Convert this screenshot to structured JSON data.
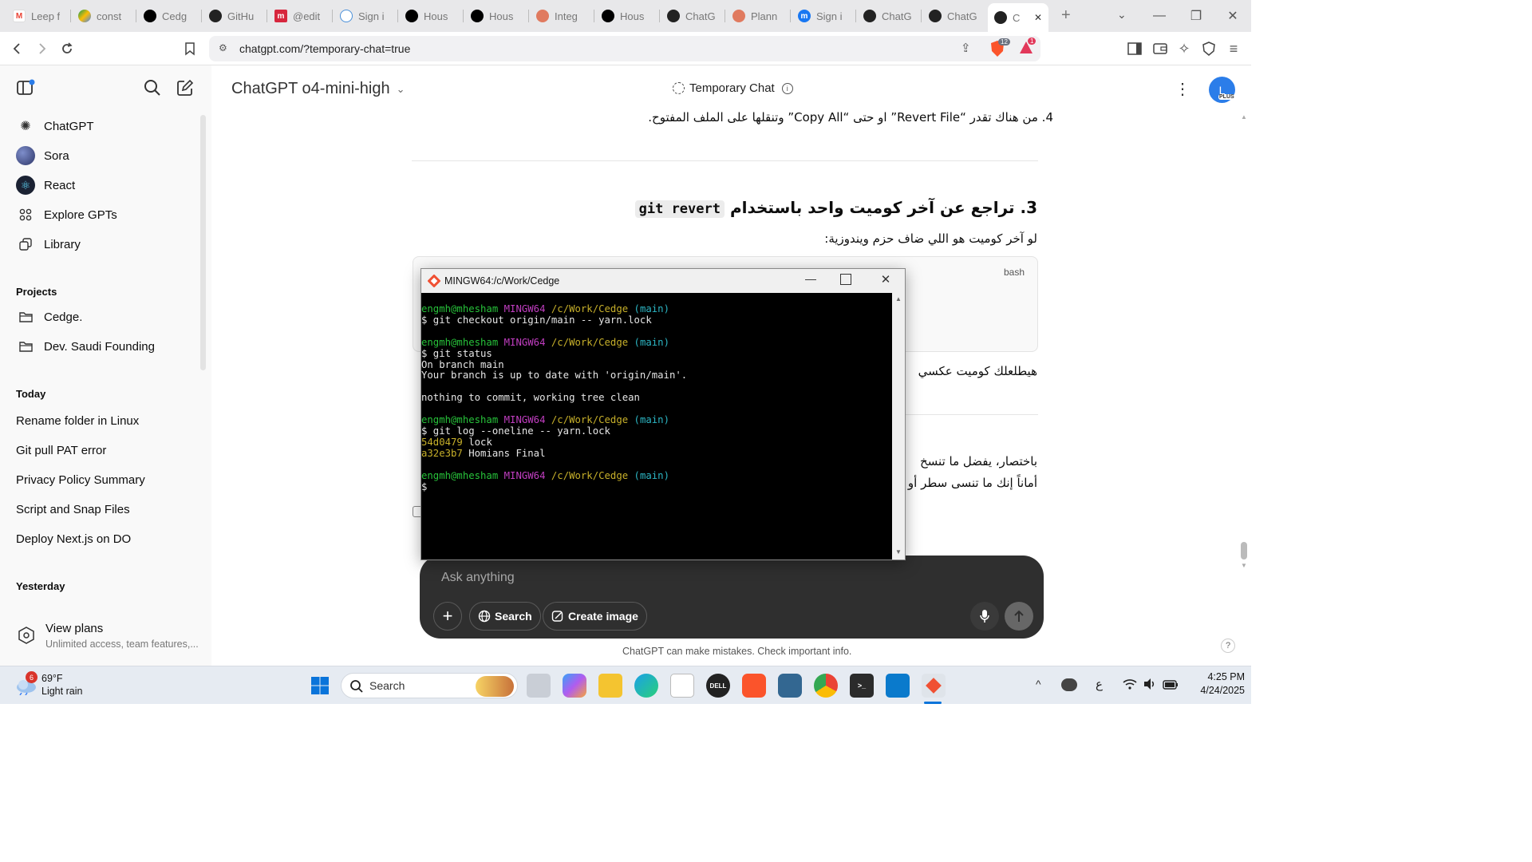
{
  "browser": {
    "tabs": [
      {
        "label": "Leep f",
        "icon": "gmail-icon"
      },
      {
        "label": "const",
        "icon": "google-drive-icon"
      },
      {
        "label": "Cedg",
        "icon": "vercel-icon"
      },
      {
        "label": "GitHu",
        "icon": "github-icon"
      },
      {
        "label": "@edit",
        "icon": "monday-icon"
      },
      {
        "label": "Sign i",
        "icon": "cloud-icon"
      },
      {
        "label": "Hous",
        "icon": "vercel-icon"
      },
      {
        "label": "Hous",
        "icon": "vercel-icon"
      },
      {
        "label": "Integ",
        "icon": "claude-icon"
      },
      {
        "label": "Hous",
        "icon": "vercel-icon"
      },
      {
        "label": "ChatG",
        "icon": "chatgpt-icon"
      },
      {
        "label": "Plann",
        "icon": "claude-icon"
      },
      {
        "label": "Sign i",
        "icon": "meta-icon"
      },
      {
        "label": "ChatG",
        "icon": "chatgpt-icon"
      },
      {
        "label": "ChatG",
        "icon": "chatgpt-icon"
      },
      {
        "label": "C",
        "icon": "chatgpt-icon"
      }
    ],
    "url": "chatgpt.com/?temporary-chat=true",
    "brave_shield_count": "12",
    "rewards_badge": "1"
  },
  "sidebar": {
    "nav": [
      {
        "label": "ChatGPT",
        "icon": "chatgpt-icon"
      },
      {
        "label": "Sora",
        "icon": "sora-icon"
      },
      {
        "label": "React",
        "icon": "react-icon"
      },
      {
        "label": "Explore GPTs",
        "icon": "grid-icon"
      },
      {
        "label": "Library",
        "icon": "library-icon"
      }
    ],
    "projects_heading": "Projects",
    "projects": [
      "Cedge.",
      "Dev. Saudi Founding"
    ],
    "today_heading": "Today",
    "today": [
      "Rename folder in Linux",
      "Git pull PAT error",
      "Privacy Policy Summary",
      "Script and Snap Files",
      "Deploy Next.js on DO"
    ],
    "yesterday_heading": "Yesterday",
    "plans_title": "View plans",
    "plans_sub": "Unlimited access, team features,..."
  },
  "header": {
    "model": "ChatGPT o4-mini-high",
    "temporary": "Temporary Chat",
    "avatar_letter": "L",
    "avatar_badge": "PLUS"
  },
  "content": {
    "item4_prefix": "4.",
    "item4_text": "من هناك تقدر “Revert File” او حتى “Copy All” وتنقلها على الملف المفتوح.",
    "section3_number": "3.",
    "section3_title": "تراجع عن آخر كوميت واحد باستخدام",
    "section3_code": "git revert",
    "section3_body": "لو آخر كوميت هو اللي ضاف حزم ويندوزية:",
    "code_lang": "bash",
    "line_after_code": "هيطلعلك كوميت عكسي",
    "summary_line1": "باختصار، يفضل ما تنسخ",
    "summary_line2": "أماناً إنك ما تنسى سطر أو"
  },
  "terminal": {
    "title": "MINGW64:/c/Work/Cedge",
    "user": "engmh@mhesham",
    "env": "MINGW64",
    "path": "/c/Work/Cedge",
    "branch": "(main)",
    "cmd1": "$ git checkout origin/main -- yarn.lock",
    "cmd2": "$ git status",
    "out2a": "On branch main",
    "out2b": "Your branch is up to date with 'origin/main'.",
    "out2c": "nothing to commit, working tree clean",
    "cmd3": "$ git log --oneline -- yarn.lock",
    "log1_hash": "54d0479",
    "log1_msg": " lock",
    "log2_hash": "a32e3b7",
    "log2_msg": " Homians Final",
    "prompt": "$"
  },
  "composer": {
    "placeholder": "Ask anything",
    "search_label": "Search",
    "create_image_label": "Create image"
  },
  "footer_note": "ChatGPT can make mistakes. Check important info.",
  "help": "?",
  "taskbar": {
    "weather_temp": "69°F",
    "weather_desc": "Light rain",
    "weather_badge": "6",
    "search_label": "Search",
    "time": "4:25 PM",
    "date": "4/24/2025",
    "lang": "ع"
  }
}
